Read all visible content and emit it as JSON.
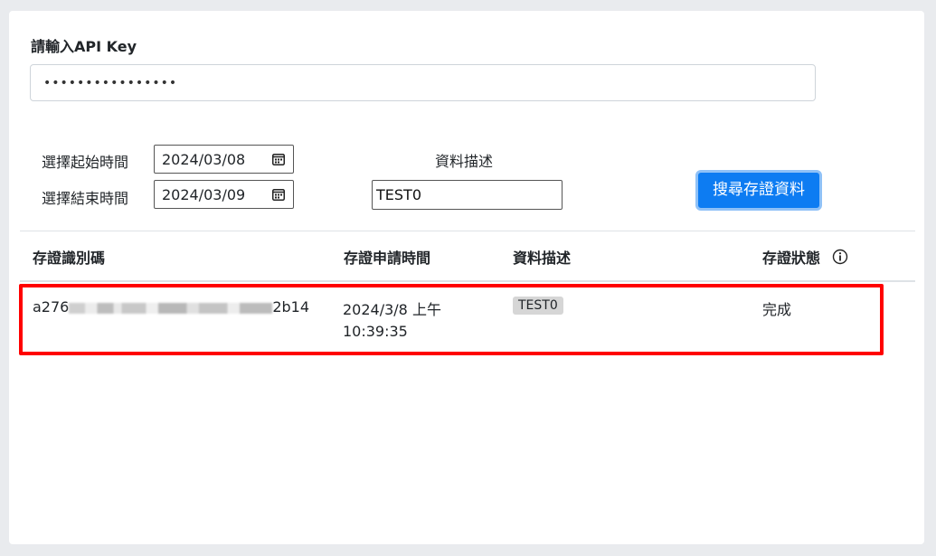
{
  "api": {
    "label": "請輸入API Key",
    "value_masked": "••••••••••••••••"
  },
  "filters": {
    "start_label": "選擇起始時間",
    "start_value": "2024/03/08",
    "end_label": "選擇結束時間",
    "end_value": "2024/03/09",
    "desc_label": "資料描述",
    "desc_value": "TEST0",
    "search_button": "搜尋存證資料"
  },
  "table": {
    "headers": [
      "存證識別碼",
      "存證申請時間",
      "資料描述",
      "存證狀態"
    ],
    "rows": [
      {
        "id_prefix": "a276",
        "id_suffix": "2b14",
        "time_line1": "2024/3/8 上午",
        "time_line2": "10:39:35",
        "desc": "TEST0",
        "status": "完成"
      }
    ]
  },
  "colors": {
    "primary": "#0d7cf2",
    "highlight": "#ff0000"
  }
}
